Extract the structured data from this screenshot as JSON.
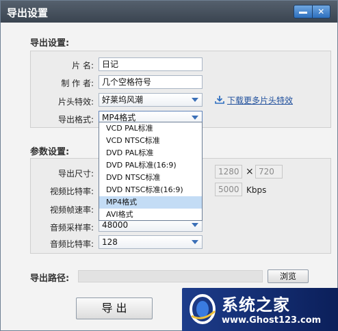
{
  "window": {
    "title": "导出设置"
  },
  "title_buttons": {
    "minimize_icon": "minimize-icon",
    "close_icon": "close-icon",
    "close_glyph": "✕"
  },
  "export_section": {
    "title": "导出设置:",
    "name_label": "片   名:",
    "name_value": "日记",
    "author_label": "制 作 者:",
    "author_value": "几个空格符号",
    "effect_label": "片头特效:",
    "effect_value": "好莱坞风潮",
    "download_link": "下载更多片头特效",
    "format_label": "导出格式:",
    "format_value": "MP4格式"
  },
  "format_dropdown": {
    "options": [
      "VCD PAL标准",
      "VCD NTSC标准",
      "DVD PAL标准",
      "DVD PAL标准(16:9)",
      "DVD NTSC标准",
      "DVD NTSC标准(16:9)",
      "MP4格式",
      "AVI格式"
    ],
    "selected_index": 6
  },
  "params_section": {
    "title": "参数设置:",
    "size_label": "导出尺寸:",
    "width": "1280",
    "times": "×",
    "height": "720",
    "video_bitrate_label": "视频比特率:",
    "video_bitrate_value": "5000",
    "video_bitrate_unit": "Kbps",
    "framerate_label": "视频帧速率:",
    "audio_samplerate_label": "音频采样率:",
    "audio_samplerate_value": "48000",
    "audio_bitrate_label": "音频比特率:",
    "audio_bitrate_value": "128"
  },
  "path": {
    "label": "导出路径:",
    "browse_label": "浏览"
  },
  "export_button": {
    "label": "导 出"
  },
  "watermark": {
    "title": "系统之家",
    "url": "www.Ghost123.com"
  }
}
